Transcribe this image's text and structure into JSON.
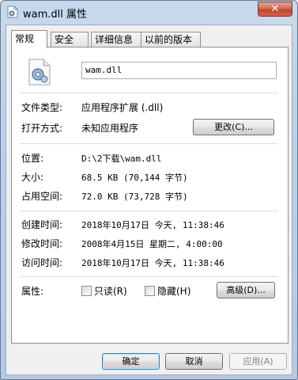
{
  "window": {
    "title": "wam.dll 属性",
    "close_glyph": "✕"
  },
  "tabs": [
    {
      "label": "常规"
    },
    {
      "label": "安全"
    },
    {
      "label": "详细信息"
    },
    {
      "label": "以前的版本"
    }
  ],
  "general": {
    "file_name": "wam.dll",
    "file_type_label": "文件类型:",
    "file_type_value": "应用程序扩展 (.dll)",
    "open_with_label": "打开方式:",
    "open_with_value": "未知应用程序",
    "change_button": "更改(C)...",
    "location_label": "位置:",
    "location_value": "D:\\2下载\\wam.dll",
    "size_label": "大小:",
    "size_value": "68.5 KB (70,144 字节)",
    "disk_size_label": "占用空间:",
    "disk_size_value": "72.0 KB (73,728 字节)",
    "created_label": "创建时间:",
    "created_value": "2018年10月17日 今天, 11:38:46",
    "modified_label": "修改时间:",
    "modified_value": "2008年4月15日 星期二, 4:00:00",
    "accessed_label": "访问时间:",
    "accessed_value": "2018年10月17日 今天, 11:38:46",
    "attributes_label": "属性:",
    "readonly_label": "只读(R)",
    "readonly_checked": false,
    "hidden_label": "隐藏(H)",
    "hidden_checked": false,
    "advanced_button": "高级(D)..."
  },
  "buttons": {
    "ok": "确定",
    "cancel": "取消",
    "apply": "应用(A)"
  }
}
